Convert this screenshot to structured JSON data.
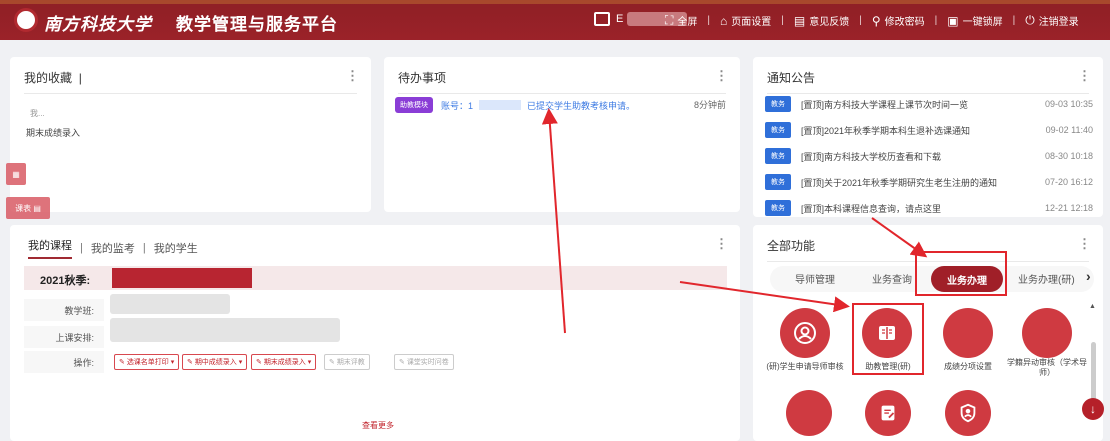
{
  "header": {
    "university": "南方科技大学",
    "platform": "教学管理与服务平台",
    "user_prefix": "E",
    "tools": [
      {
        "icon": "fullscreen-icon",
        "label": "全屏"
      },
      {
        "icon": "page-settings-icon",
        "label": "页面设置"
      },
      {
        "icon": "feedback-icon",
        "label": "意见反馈"
      },
      {
        "icon": "key-icon",
        "label": "修改密码"
      },
      {
        "icon": "lock-icon",
        "label": "一键锁屏"
      },
      {
        "icon": "logout-icon",
        "label": "注销登录"
      }
    ]
  },
  "favorites": {
    "title": "我的收藏",
    "separator": "|",
    "item_hint": "我...",
    "item_label": "期末成绩录入"
  },
  "pending": {
    "title": "待办事项",
    "tag": "助教模块",
    "account_prefix": "账号：1",
    "message": "已提交学生助教考核申请。",
    "time": "8分钟前"
  },
  "announcements": {
    "title": "通知公告",
    "items": [
      {
        "badge": "教务",
        "title": "[置顶]南方科技大学课程上课节次时间一览",
        "date": "09-03 10:35"
      },
      {
        "badge": "教务",
        "title": "[置顶]2021年秋季学期本科生退补选课通知",
        "date": "09-02 11:40"
      },
      {
        "badge": "教务",
        "title": "[置顶]南方科技大学校历查看和下载",
        "date": "08-30 10:18"
      },
      {
        "badge": "教务",
        "title": "[置顶]关于2021年秋季学期研究生老生注册的通知",
        "date": "07-20 16:12"
      },
      {
        "badge": "教务",
        "title": "[置顶]本科课程信息查询，请点这里",
        "date": "12-21 12:18"
      }
    ]
  },
  "side_buttons": {
    "lower_label": "课表"
  },
  "courses": {
    "tabs": [
      "我的课程",
      "我的监考",
      "我的学生"
    ],
    "separator": "|",
    "semester": "2021秋季:",
    "rows": [
      "教学班:",
      "上课安排:",
      "操作:"
    ],
    "actions": [
      {
        "label": "选课名单打印",
        "enabled": true
      },
      {
        "label": "期中成绩录入",
        "enabled": true
      },
      {
        "label": "期末成绩录入",
        "enabled": true
      },
      {
        "label": "期末评教",
        "enabled": false
      },
      {
        "label": "课堂实时问卷",
        "enabled": false
      }
    ],
    "view_more": "查看更多"
  },
  "functions": {
    "title": "全部功能",
    "tabs": [
      "导师管理",
      "业务查询",
      "业务办理",
      "业务办理(研)"
    ],
    "active_tab": "业务办理",
    "next": "›",
    "items": [
      {
        "label": "(研)学生申请导师审核",
        "icon": "person-circle-icon"
      },
      {
        "label": "助教管理(研)",
        "icon": "book-icon"
      },
      {
        "label": "成绩分项设置",
        "icon": ""
      },
      {
        "label": "学籍异动审核（学术导师）",
        "icon": ""
      },
      {
        "label": "",
        "icon": ""
      },
      {
        "label": "",
        "icon": "edit-doc-icon"
      },
      {
        "label": "",
        "icon": "shield-user-icon"
      }
    ]
  },
  "colors": {
    "brand": "#9b2229",
    "badge_blue": "#2f6fd9",
    "pending_tag": "#8a3dd6",
    "annotation_red": "#e1262c"
  }
}
